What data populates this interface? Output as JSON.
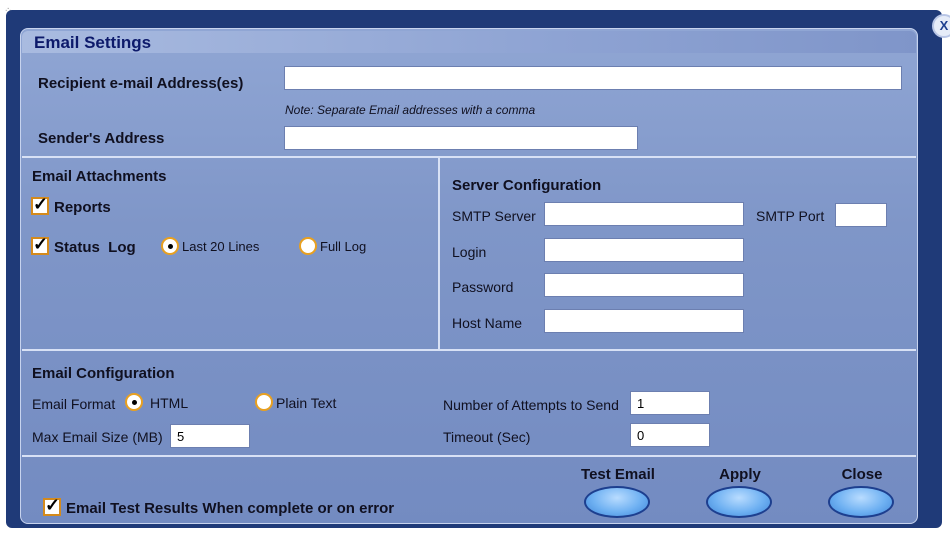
{
  "title": "Email Settings",
  "close_glyph": "X",
  "recipient": {
    "label": "Recipient e-mail Address(es)",
    "value": "",
    "note": "Note: Separate Email addresses with a comma"
  },
  "sender": {
    "label": "Sender's Address",
    "value": ""
  },
  "attachments": {
    "heading": "Email Attachments",
    "reports_label": "Reports",
    "status_log_label": "Status  Log",
    "last20_label": "Last 20 Lines",
    "fulllog_label": "Full Log",
    "reports_checked": true,
    "status_log_checked": true,
    "status_log_option": "Last 20 Lines"
  },
  "server": {
    "heading": "Server Configuration",
    "smtp_server_label": "SMTP Server",
    "smtp_server_value": "",
    "smtp_port_label": "SMTP Port",
    "smtp_port_value": "",
    "login_label": "Login",
    "login_value": "",
    "password_label": "Password",
    "password_value": "",
    "host_label": "Host Name",
    "host_value": ""
  },
  "config": {
    "heading": "Email Configuration",
    "format_label": "Email Format",
    "html_label": "HTML",
    "plain_label": "Plain Text",
    "format_selected": "HTML",
    "max_size_label": "Max Email Size (MB)",
    "max_size_value": "5",
    "attempts_label": "Number of Attempts to Send",
    "attempts_value": "1",
    "timeout_label": "Timeout (Sec)",
    "timeout_value": "0"
  },
  "footer": {
    "email_results_label": "Email Test Results When complete or on error",
    "email_results_checked": true,
    "test_label": "Test Email",
    "apply_label": "Apply",
    "close_label": "Close"
  },
  "colors": {
    "dialog_bg": "#7f96c8",
    "frame": "#1f3a78",
    "title": "#0d1a6b",
    "check_border": "#d48a1c",
    "button": "#6fb1f2"
  }
}
